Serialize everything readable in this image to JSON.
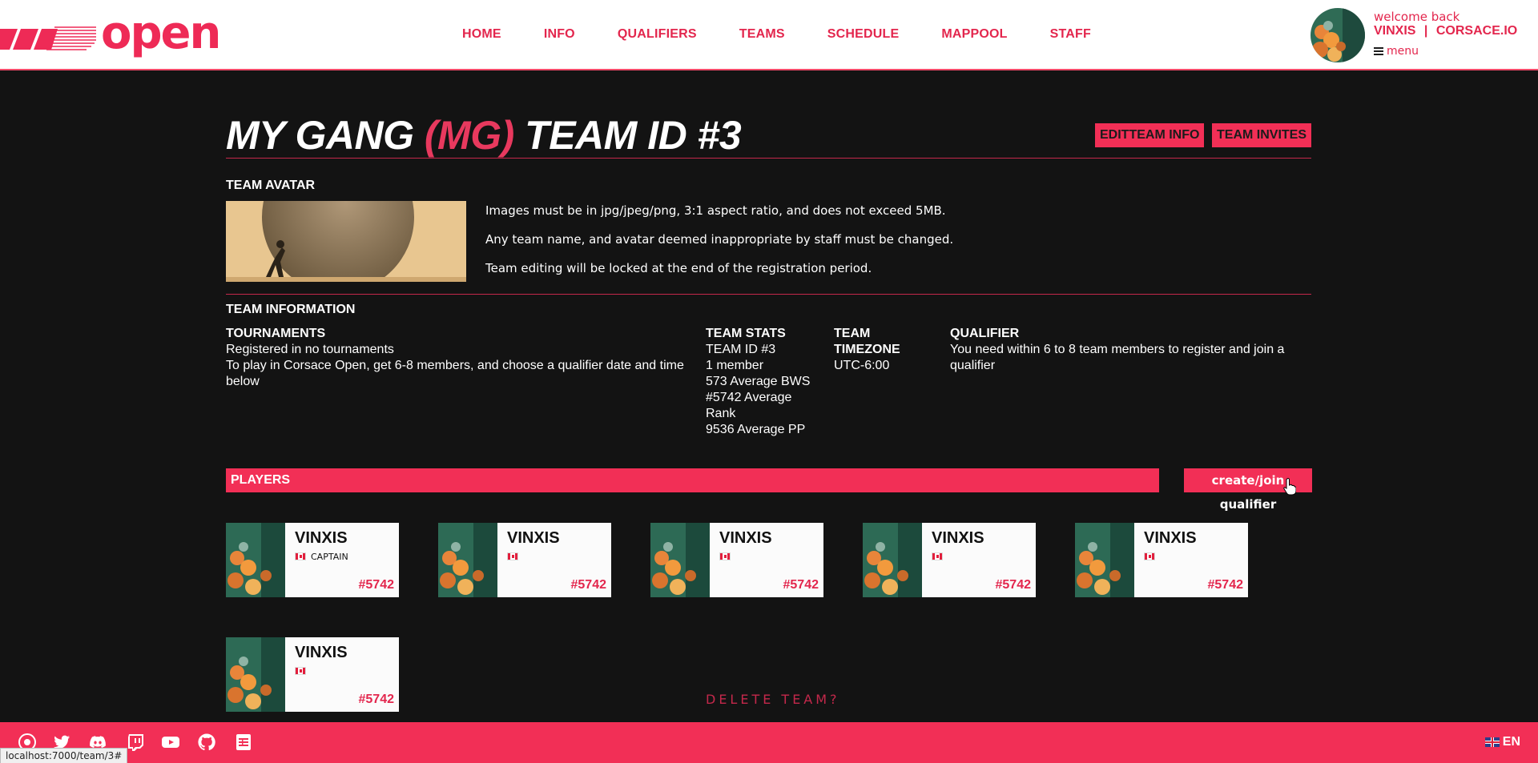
{
  "brand": {
    "logo_text": "open",
    "accent": "#f22f56"
  },
  "nav": {
    "items": [
      {
        "label": "HOME"
      },
      {
        "label": "INFO"
      },
      {
        "label": "QUALIFIERS"
      },
      {
        "label": "TEAMS"
      },
      {
        "label": "SCHEDULE"
      },
      {
        "label": "MAPPOOL"
      },
      {
        "label": "STAFF"
      }
    ]
  },
  "user": {
    "welcome": "welcome back",
    "name": "VINXIS",
    "separator": "|",
    "site": "CORSACE.IO",
    "menu_label": "menu"
  },
  "team": {
    "title_name": "MY GANG",
    "title_abbr": "(MG)",
    "title_id": "TEAM ID #3",
    "edit_button": "EDITTEAM INFO",
    "invites_button": "TEAM INVITES"
  },
  "avatar_section": {
    "heading": "TEAM AVATAR",
    "rules": [
      "Images must be in jpg/jpeg/png, 3:1 aspect ratio, and does not exceed 5MB.",
      "Any team name, and avatar deemed inappropriate by staff must be changed.",
      "Team editing will be locked at the end of the registration period."
    ]
  },
  "info_section": {
    "heading": "TEAM INFORMATION",
    "tournaments": {
      "heading": "TOURNAMENTS",
      "line1": "Registered in no tournaments",
      "line2": "To play in Corsace Open, get 6-8 members, and choose a qualifier date and time below"
    },
    "stats": {
      "heading": "TEAM STATS",
      "team_id": "TEAM ID #3",
      "members": "1 member",
      "bws": "573 Average BWS",
      "rank": "#5742 Average Rank",
      "pp": "9536 Average PP"
    },
    "timezone": {
      "heading": "TEAM TIMEZONE",
      "value": "UTC-6:00"
    },
    "qualifier": {
      "heading": "QUALIFIER",
      "text": "You need within 6 to 8 team members to register and join a qualifier"
    }
  },
  "players": {
    "heading": "PLAYERS",
    "qualifier_button": "create/join qualifier",
    "list": [
      {
        "name": "VINXIS",
        "role": "CAPTAIN",
        "rank": "#5742"
      },
      {
        "name": "VINXIS",
        "role": "",
        "rank": "#5742"
      },
      {
        "name": "VINXIS",
        "role": "",
        "rank": "#5742"
      },
      {
        "name": "VINXIS",
        "role": "",
        "rank": "#5742"
      },
      {
        "name": "VINXIS",
        "role": "",
        "rank": "#5742"
      },
      {
        "name": "VINXIS",
        "role": "",
        "rank": "#5742"
      }
    ]
  },
  "delete_team": "DELETE TEAM?",
  "footer": {
    "language": "EN",
    "icons": [
      "osu-icon",
      "twitter-icon",
      "discord-icon",
      "twitch-icon",
      "youtube-icon",
      "github-icon",
      "sheets-icon"
    ]
  },
  "status_url": "localhost:7000/team/3#"
}
